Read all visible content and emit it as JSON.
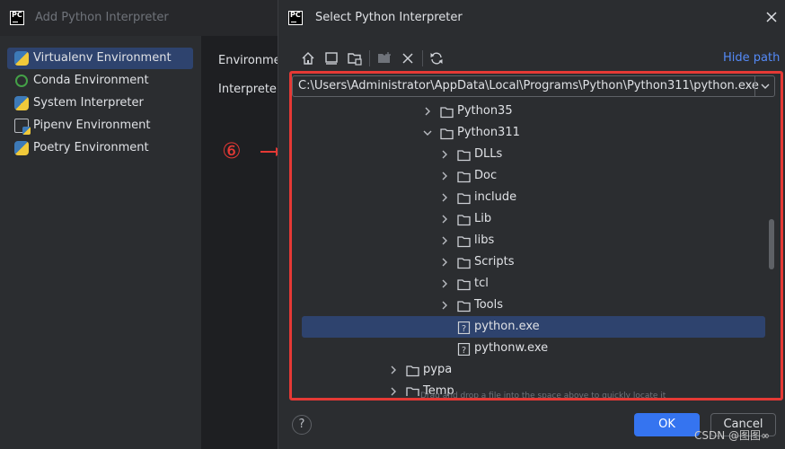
{
  "back_dialog": {
    "title": "Add Python Interpreter",
    "env_items": [
      {
        "label": "Virtualenv Environment",
        "icon": "python-icon",
        "selected": true
      },
      {
        "label": "Conda Environment",
        "icon": "conda-icon",
        "selected": false
      },
      {
        "label": "System Interpreter",
        "icon": "python-icon",
        "selected": false
      },
      {
        "label": "Pipenv Environment",
        "icon": "pipenv-icon",
        "selected": false
      },
      {
        "label": "Poetry Environment",
        "icon": "python-icon",
        "selected": false
      }
    ],
    "right_labels": [
      "Environme",
      "Interpreter"
    ]
  },
  "annotation": {
    "number": "⑥",
    "color": "#e53935"
  },
  "dialog": {
    "title": "Select Python Interpreter",
    "toolbar": [
      "home-icon",
      "desktop-icon",
      "project-folder-icon",
      "new-folder-icon",
      "delete-icon",
      "refresh-icon"
    ],
    "hide_path_label": "Hide path",
    "path_value": "C:\\Users\\Administrator\\AppData\\Local\\Programs\\Python\\Python311\\python.exe",
    "tree": [
      {
        "label": "Python35",
        "type": "folder",
        "expanded": false
      },
      {
        "label": "Python311",
        "type": "folder",
        "expanded": true
      },
      {
        "label": "DLLs",
        "type": "folder",
        "expanded": false
      },
      {
        "label": "Doc",
        "type": "folder",
        "expanded": false
      },
      {
        "label": "include",
        "type": "folder",
        "expanded": false
      },
      {
        "label": "Lib",
        "type": "folder",
        "expanded": false
      },
      {
        "label": "libs",
        "type": "folder",
        "expanded": false
      },
      {
        "label": "Scripts",
        "type": "folder",
        "expanded": false
      },
      {
        "label": "tcl",
        "type": "folder",
        "expanded": false
      },
      {
        "label": "Tools",
        "type": "folder",
        "expanded": false
      },
      {
        "label": "python.exe",
        "type": "file",
        "selected": true
      },
      {
        "label": "pythonw.exe",
        "type": "file"
      },
      {
        "label": "pypa",
        "type": "folder",
        "expanded": false
      },
      {
        "label": "Temp",
        "type": "folder",
        "expanded": false
      }
    ],
    "drag_hint": "Drag and drop a file into the space above to quickly locate it",
    "help_label": "?",
    "ok_label": "OK",
    "cancel_label": "Cancel"
  },
  "watermark": "CSDN @图图∞",
  "colors": {
    "accent": "#3574f0",
    "selection": "#2e436e",
    "highlight_border": "#e53935",
    "link": "#548af7"
  }
}
